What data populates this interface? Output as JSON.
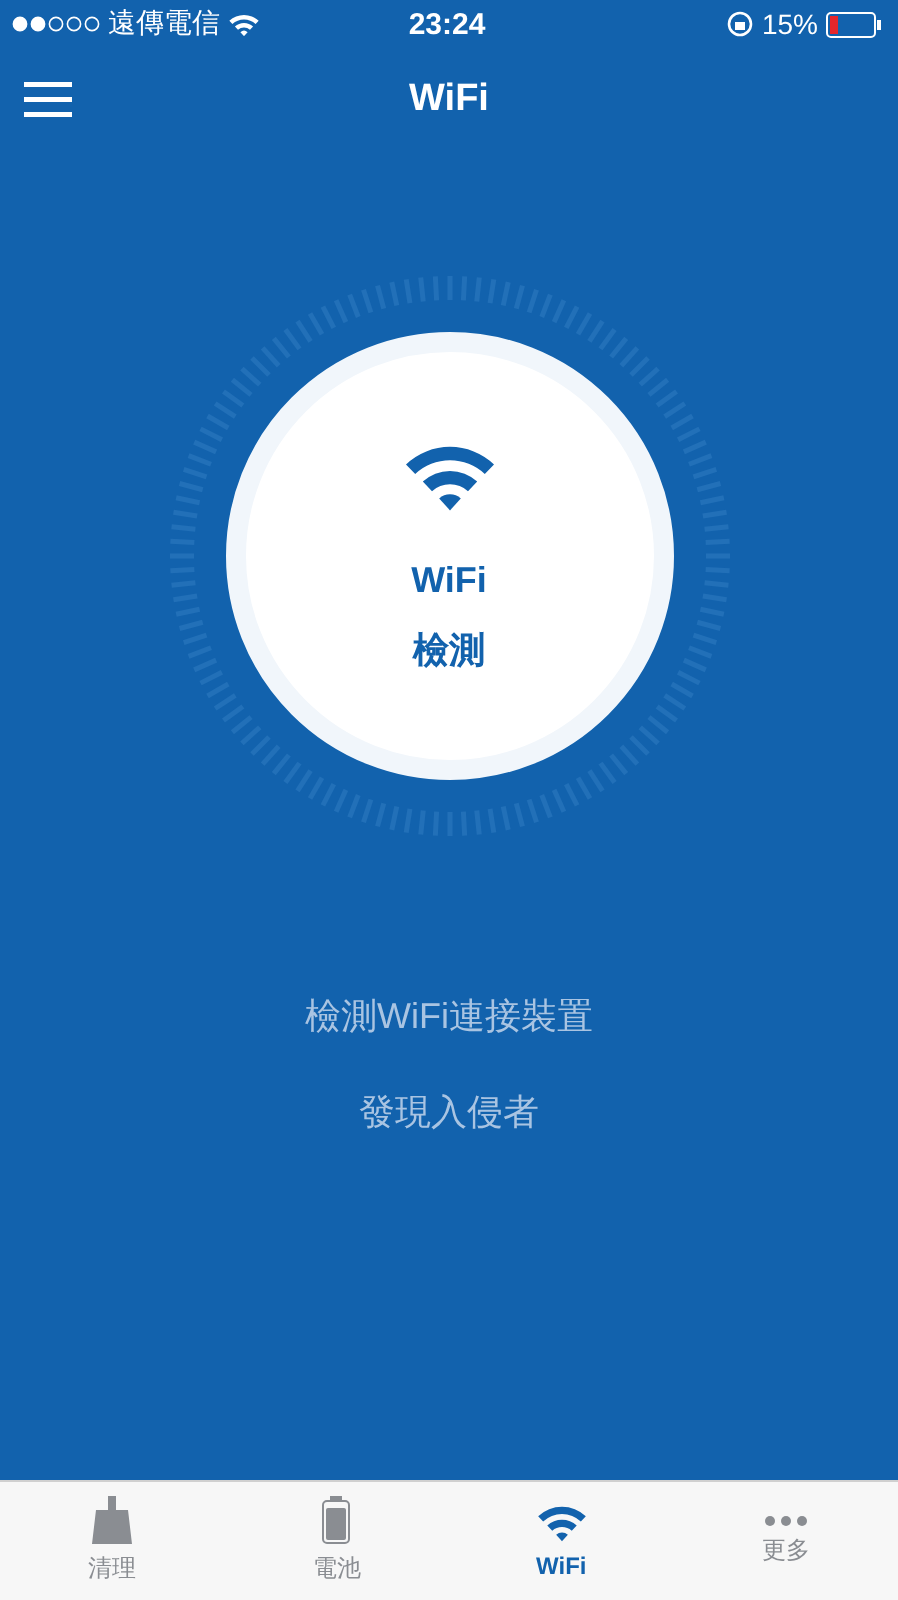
{
  "status_bar": {
    "carrier": "遠傳電信",
    "time": "23:24",
    "battery": "15%"
  },
  "nav": {
    "title": "WiFi"
  },
  "scan_button": {
    "line_1": "WiFi",
    "line_2": "檢測"
  },
  "features": [
    "檢測WiFi連接裝置",
    "發現入侵者"
  ],
  "tabs": [
    {
      "kind": "clean",
      "label": "清理",
      "selected": false
    },
    {
      "kind": "battery",
      "label": "電池",
      "selected": false
    },
    {
      "kind": "wifi",
      "label": "WiFi",
      "selected": true
    },
    {
      "kind": "more",
      "label": "更多",
      "selected": false
    }
  ]
}
